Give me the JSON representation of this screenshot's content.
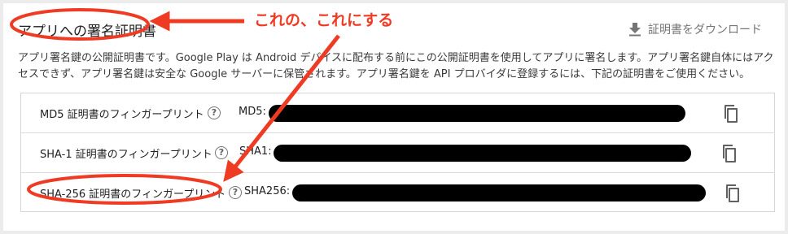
{
  "section": {
    "title": "アプリへの署名証明書",
    "download_label": "証明書をダウンロード",
    "download_icon": "download-icon",
    "description": "アプリ署名鍵の公開証明書です。Google Play は Android デバイスに配布する前にこの公開証明書を使用してアプリに署名します。アプリ署名鍵自体にはアクセスできず、アプリ署名鍵は安全な Google サーバーに保管されます。アプリ署名鍵を API プロバイダに登録するには、下記の証明書をご使用ください。"
  },
  "fingerprints": [
    {
      "label": "MD5 証明書のフィンガープリント",
      "help": "?",
      "prefix": "MD5:"
    },
    {
      "label": "SHA-1 証明書のフィンガープリント",
      "help": "?",
      "prefix": "SHA1:"
    },
    {
      "label": "SHA-256 証明書のフィンガープリント",
      "help": "?",
      "prefix": "SHA256:"
    }
  ],
  "annotation": {
    "text": "これの、これにする",
    "color": "#ef3b24"
  },
  "colors": {
    "background": "#ececec",
    "card": "#ffffff",
    "border": "#d6d6d6",
    "icon_gray": "#757575",
    "annotation_red": "#ef3b24"
  }
}
